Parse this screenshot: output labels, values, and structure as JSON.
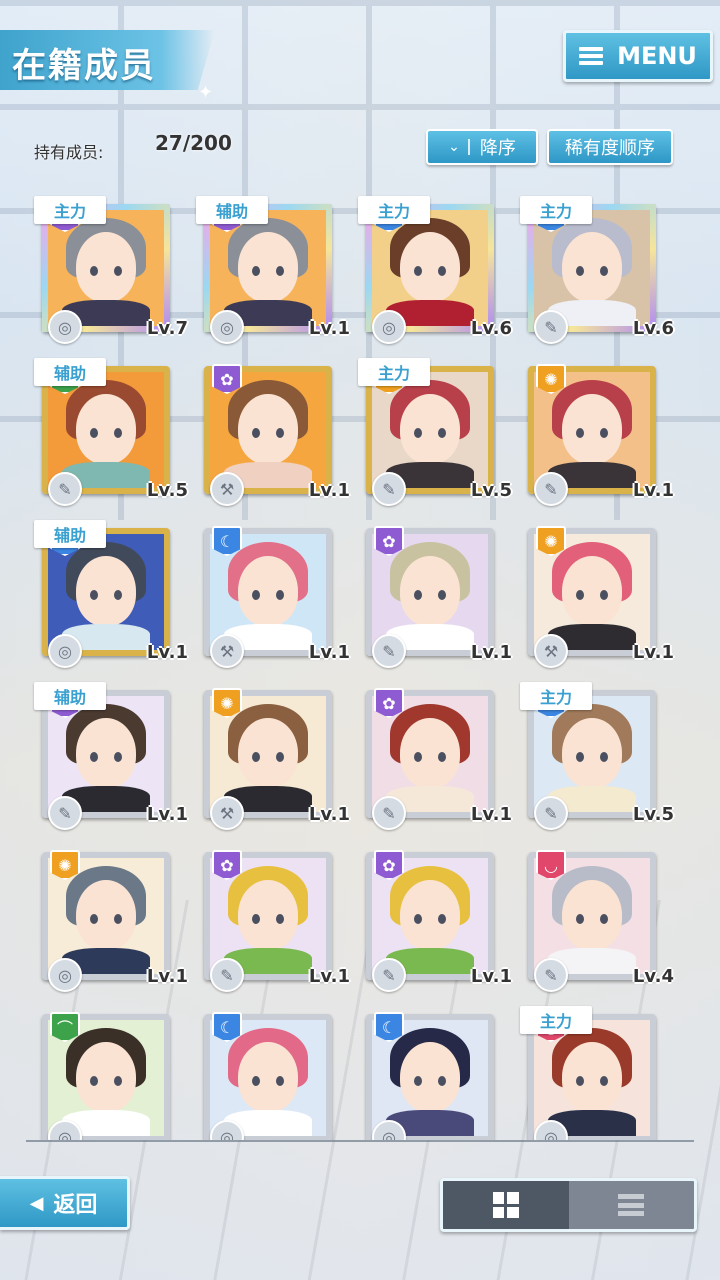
{
  "header": {
    "title": "在籍成员",
    "menu_label": "MENU",
    "member_count_label": "持有成员:",
    "member_count_value": "27/200",
    "order_label": "降序",
    "order_icon": "⌄",
    "rarity_sort_label": "稀有度顺序"
  },
  "members": [
    {
      "role": "主力",
      "level": "Lv.7",
      "frame": "rainbow",
      "attr": "purple",
      "attr_icon": "✿",
      "type_icon": "◎",
      "hair": "#8a8f98",
      "outfit": "#3c3a55",
      "bg": "#f6b35a"
    },
    {
      "role": "辅助",
      "level": "Lv.1",
      "frame": "rainbow",
      "attr": "purple",
      "attr_icon": "✿",
      "type_icon": "◎",
      "hair": "#8a8f98",
      "outfit": "#3c3a55",
      "bg": "#f6b35a"
    },
    {
      "role": "主力",
      "level": "Lv.6",
      "frame": "rainbow",
      "attr": "blue",
      "attr_icon": "☾",
      "type_icon": "◎",
      "hair": "#6a3e28",
      "outfit": "#b02030",
      "bg": "#f3d08a"
    },
    {
      "role": "主力",
      "level": "Lv.6",
      "frame": "rainbow",
      "attr": "blue",
      "attr_icon": "☾",
      "type_icon": "✎",
      "hair": "#b9bccd",
      "outfit": "#eef0f6",
      "bg": "#d8c3a8"
    },
    {
      "role": "辅助",
      "level": "Lv.5",
      "frame": "gold",
      "attr": "green",
      "attr_icon": "⌒",
      "type_icon": "✎",
      "hair": "#9a4a30",
      "outfit": "#7fb8b0",
      "bg": "#f39a3a"
    },
    {
      "role": "",
      "level": "Lv.1",
      "frame": "gold",
      "attr": "purple",
      "attr_icon": "✿",
      "type_icon": "⚒",
      "hair": "#8a5a38",
      "outfit": "#f0d0c0",
      "bg": "#f5a63e"
    },
    {
      "role": "主力",
      "level": "Lv.5",
      "frame": "gold",
      "attr": "orange",
      "attr_icon": "✺",
      "type_icon": "✎",
      "hair": "#b8404a",
      "outfit": "#3a3438",
      "bg": "#e9d8c8"
    },
    {
      "role": "",
      "level": "Lv.1",
      "frame": "gold",
      "attr": "orange",
      "attr_icon": "✺",
      "type_icon": "✎",
      "hair": "#b8404a",
      "outfit": "#3a3438",
      "bg": "#f4c08a"
    },
    {
      "role": "辅助",
      "level": "Lv.1",
      "frame": "gold",
      "attr": "blue",
      "attr_icon": "☾",
      "type_icon": "◎",
      "hair": "#404a5a",
      "outfit": "#d8e8f0",
      "bg": "#3f5cb8"
    },
    {
      "role": "",
      "level": "Lv.1",
      "frame": "silver",
      "attr": "blue",
      "attr_icon": "☾",
      "type_icon": "⚒",
      "hair": "#e27088",
      "outfit": "#ffffff",
      "bg": "#cfe6f6"
    },
    {
      "role": "",
      "level": "Lv.1",
      "frame": "silver",
      "attr": "purple",
      "attr_icon": "✿",
      "type_icon": "✎",
      "hair": "#c9c2a0",
      "outfit": "#ffffff",
      "bg": "#e6d9ef"
    },
    {
      "role": "",
      "level": "Lv.1",
      "frame": "silver",
      "attr": "orange",
      "attr_icon": "✺",
      "type_icon": "⚒",
      "hair": "#e2607a",
      "outfit": "#2e2c30",
      "bg": "#f6eadc"
    },
    {
      "role": "辅助",
      "level": "Lv.1",
      "frame": "silver",
      "attr": "purple",
      "attr_icon": "✿",
      "type_icon": "✎",
      "hair": "#4a3a30",
      "outfit": "#2a2a30",
      "bg": "#ede4f5"
    },
    {
      "role": "",
      "level": "Lv.1",
      "frame": "silver",
      "attr": "orange",
      "attr_icon": "✺",
      "type_icon": "⚒",
      "hair": "#8a6040",
      "outfit": "#2a2a30",
      "bg": "#f6ead4"
    },
    {
      "role": "",
      "level": "Lv.1",
      "frame": "silver",
      "attr": "purple",
      "attr_icon": "✿",
      "type_icon": "✎",
      "hair": "#a0382e",
      "outfit": "#f6e8d8",
      "bg": "#f0dde6"
    },
    {
      "role": "主力",
      "level": "Lv.5",
      "frame": "silver",
      "attr": "blue",
      "attr_icon": "☾",
      "type_icon": "✎",
      "hair": "#a07a5a",
      "outfit": "#f4ead0",
      "bg": "#dce8f4"
    },
    {
      "role": "",
      "level": "Lv.1",
      "frame": "silver",
      "attr": "orange",
      "attr_icon": "✺",
      "type_icon": "◎",
      "hair": "#6a7888",
      "outfit": "#2e3a5a",
      "bg": "#f6ecd8"
    },
    {
      "role": "",
      "level": "Lv.1",
      "frame": "silver",
      "attr": "purple",
      "attr_icon": "✿",
      "type_icon": "✎",
      "hair": "#e8c040",
      "outfit": "#7ab850",
      "bg": "#ece2f4"
    },
    {
      "role": "",
      "level": "Lv.1",
      "frame": "silver",
      "attr": "purple",
      "attr_icon": "✿",
      "type_icon": "✎",
      "hair": "#e8c040",
      "outfit": "#7ab850",
      "bg": "#ece2f4"
    },
    {
      "role": "",
      "level": "Lv.4",
      "frame": "silver",
      "attr": "red",
      "attr_icon": "◡",
      "type_icon": "✎",
      "hair": "#b8bcc8",
      "outfit": "#f4f4f6",
      "bg": "#f4e0e4"
    },
    {
      "role": "",
      "level": "",
      "frame": "silver",
      "attr": "green",
      "attr_icon": "⌒",
      "type_icon": "◎",
      "hair": "#3a3028",
      "outfit": "#ffffff",
      "bg": "#e4f0d4"
    },
    {
      "role": "",
      "level": "",
      "frame": "silver",
      "attr": "blue",
      "attr_icon": "☾",
      "type_icon": "◎",
      "hair": "#e26a88",
      "outfit": "#ffffff",
      "bg": "#dce8f6"
    },
    {
      "role": "",
      "level": "",
      "frame": "silver",
      "attr": "blue",
      "attr_icon": "☾",
      "type_icon": "◎",
      "hair": "#262a48",
      "outfit": "#4a4a7a",
      "bg": "#dfe6f4"
    },
    {
      "role": "主力",
      "level": "",
      "frame": "silver",
      "attr": "red",
      "attr_icon": "◡",
      "type_icon": "◎",
      "hair": "#9a3a2a",
      "outfit": "#2a3048",
      "bg": "#f6e4dc"
    }
  ],
  "footer": {
    "back_label": "返回",
    "back_icon": "◀",
    "view_modes": [
      "grid",
      "list"
    ],
    "active_view": "grid"
  }
}
